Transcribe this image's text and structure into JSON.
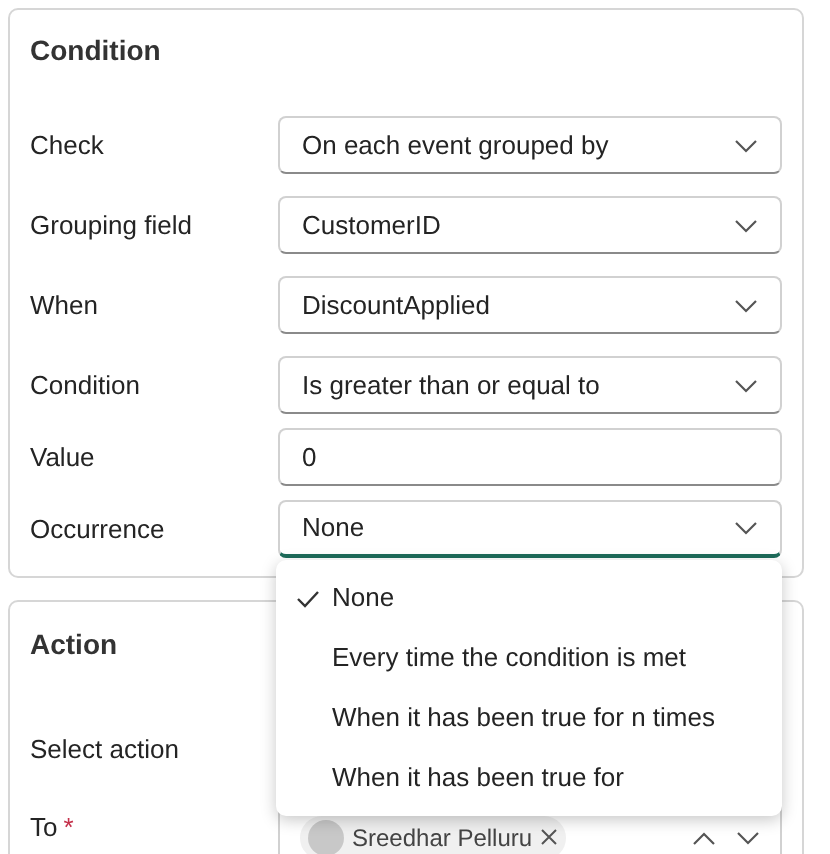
{
  "condition": {
    "title": "Condition",
    "rows": [
      {
        "kind": "select",
        "label": "Check",
        "value": "On each event grouped by",
        "focused": false
      },
      {
        "kind": "select",
        "label": "Grouping field",
        "value": "CustomerID",
        "focused": false
      },
      {
        "kind": "select",
        "label": "When",
        "value": "DiscountApplied",
        "focused": false
      },
      {
        "kind": "select",
        "label": "Condition",
        "value": "Is greater than or equal to",
        "focused": false
      },
      {
        "kind": "input",
        "label": "Value",
        "value": "0",
        "focused": false
      },
      {
        "kind": "select",
        "label": "Occurrence",
        "value": "None",
        "focused": true
      }
    ]
  },
  "occurrence_menu": {
    "options": [
      {
        "label": "None",
        "selected": true
      },
      {
        "label": "Every time the condition is met",
        "selected": false
      },
      {
        "label": "When it has been true for n times",
        "selected": false
      },
      {
        "label": "When it has been true for",
        "selected": false
      }
    ]
  },
  "action": {
    "title": "Action",
    "select_action_label": "Select action",
    "to": {
      "label": "To",
      "required_mark": "*",
      "recipient": "Sreedhar Pelluru"
    }
  }
}
